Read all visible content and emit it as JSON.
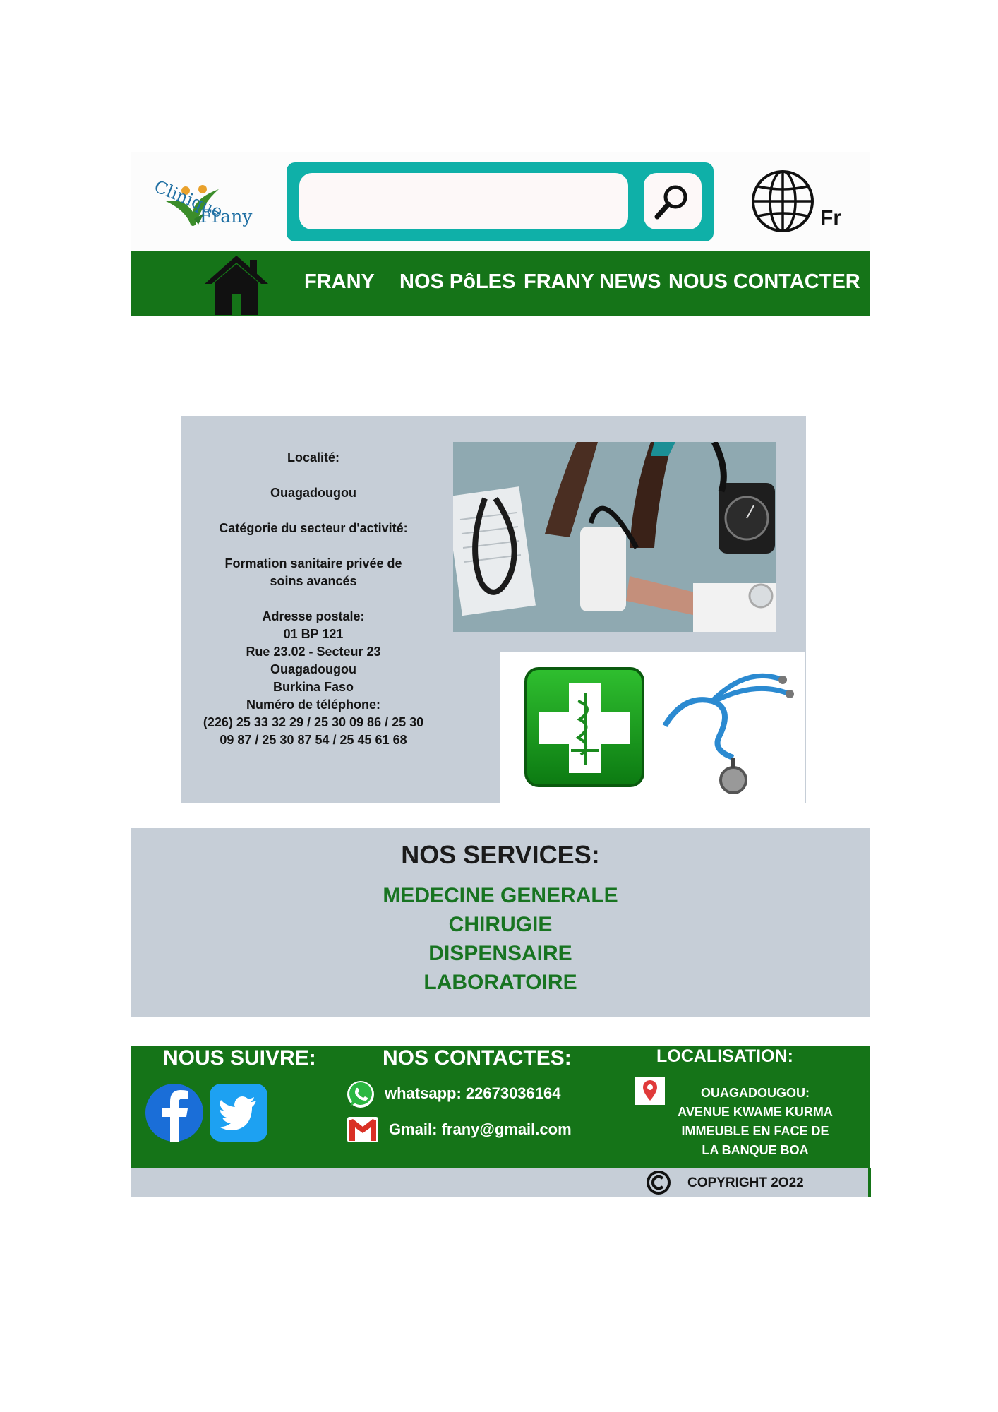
{
  "header": {
    "logo_line1": "Clinique",
    "logo_line2": "Frany",
    "search": {
      "value": "",
      "placeholder": ""
    },
    "language": "Fr"
  },
  "nav": {
    "items": [
      "FRANY",
      "NOS PôLES",
      "FRANY NEWS",
      "NOUS CONTACTER"
    ]
  },
  "info": {
    "locality_label": "Localité:",
    "locality_value": "Ouagadougou",
    "category_label": "Catégorie du secteur d'activité:",
    "category_value_line1": "Formation sanitaire privée de",
    "category_value_line2": "soins avancés",
    "postal_label": "Adresse postale:",
    "postal_lines": [
      "01 BP 121",
      "Rue 23.02 - Secteur 23",
      "Ouagadougou",
      "Burkina Faso"
    ],
    "phone_label": "Numéro de téléphone:",
    "phone_line1": "(226) 25 33 32 29 / 25 30 09 86 / 25 30",
    "phone_line2": "09 87 / 25 30 87 54 / 25 45 61 68"
  },
  "services": {
    "title": "NOS SERVICES:",
    "items": [
      "MEDECINE GENERALE",
      "CHIRUGIE",
      "DISPENSAIRE",
      "LABORATOIRE"
    ]
  },
  "footer": {
    "follow_title": "NOUS SUIVRE:",
    "contacts_title": "NOS CONTACTES:",
    "whatsapp": "whatsapp: 22673036164",
    "gmail": "Gmail: frany@gmail.com",
    "location_title": "LOCALISATION:",
    "location_lines": [
      "OUAGADOUGOU:",
      "AVENUE KWAME KURMA",
      "IMMEUBLE EN FACE DE",
      "LA BANQUE BOA"
    ],
    "copyright": "COPYRIGHT 2O22"
  },
  "colors": {
    "nav_green": "#157418",
    "search_teal": "#0fb0a8",
    "panel_grey": "#c6ced7",
    "service_green": "#187421"
  }
}
